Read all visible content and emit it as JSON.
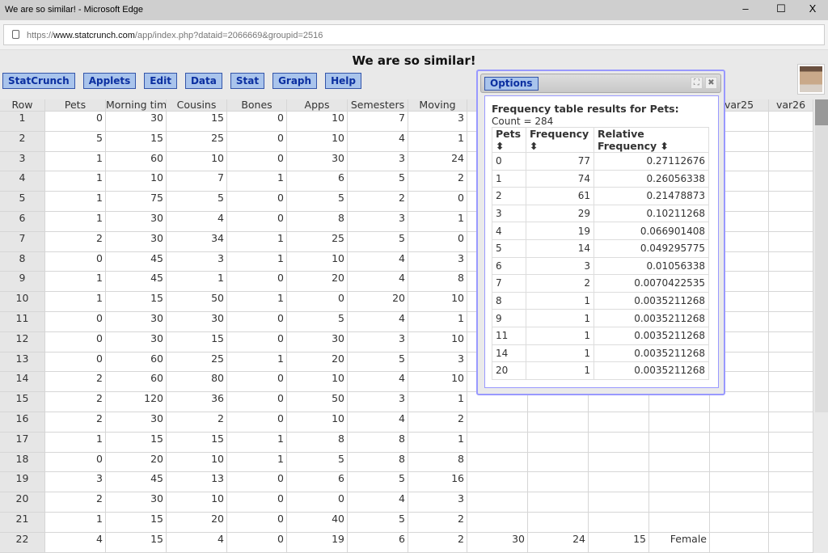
{
  "window": {
    "title": "We are so similar! - Microsoft Edge",
    "minimize": "–",
    "maximize": "☐",
    "close": "X"
  },
  "address": {
    "prefix": "https://",
    "domain": "www.statcrunch.com",
    "path": "/app/index.php?dataid=2066669&groupid=2516"
  },
  "page_title": "We are so similar!",
  "menu": [
    "StatCrunch",
    "Applets",
    "Edit",
    "Data",
    "Stat",
    "Graph",
    "Help"
  ],
  "grid": {
    "headers": [
      "Row",
      "Pets",
      "Morning tim",
      "Cousins",
      "Bones",
      "Apps",
      "Semesters",
      "Moving",
      "",
      "",
      "",
      "",
      "var25",
      "var26"
    ],
    "rows": [
      [
        "1",
        "0",
        "30",
        "15",
        "0",
        "10",
        "7",
        "3"
      ],
      [
        "2",
        "5",
        "15",
        "25",
        "0",
        "10",
        "4",
        "1"
      ],
      [
        "3",
        "1",
        "60",
        "10",
        "0",
        "30",
        "3",
        "24"
      ],
      [
        "4",
        "1",
        "10",
        "7",
        "1",
        "6",
        "5",
        "2"
      ],
      [
        "5",
        "1",
        "75",
        "5",
        "0",
        "5",
        "2",
        "0"
      ],
      [
        "6",
        "1",
        "30",
        "4",
        "0",
        "8",
        "3",
        "1"
      ],
      [
        "7",
        "2",
        "30",
        "34",
        "1",
        "25",
        "5",
        "0"
      ],
      [
        "8",
        "0",
        "45",
        "3",
        "1",
        "10",
        "4",
        "3"
      ],
      [
        "9",
        "1",
        "45",
        "1",
        "0",
        "20",
        "4",
        "8"
      ],
      [
        "10",
        "1",
        "15",
        "50",
        "1",
        "0",
        "20",
        "10"
      ],
      [
        "11",
        "0",
        "30",
        "30",
        "0",
        "5",
        "4",
        "1"
      ],
      [
        "12",
        "0",
        "30",
        "15",
        "0",
        "30",
        "3",
        "10"
      ],
      [
        "13",
        "0",
        "60",
        "25",
        "1",
        "20",
        "5",
        "3"
      ],
      [
        "14",
        "2",
        "60",
        "80",
        "0",
        "10",
        "4",
        "10"
      ],
      [
        "15",
        "2",
        "120",
        "36",
        "0",
        "50",
        "3",
        "1"
      ],
      [
        "16",
        "2",
        "30",
        "2",
        "0",
        "10",
        "4",
        "2"
      ],
      [
        "17",
        "1",
        "15",
        "15",
        "1",
        "8",
        "8",
        "1"
      ],
      [
        "18",
        "0",
        "20",
        "10",
        "1",
        "5",
        "8",
        "8"
      ],
      [
        "19",
        "3",
        "45",
        "13",
        "0",
        "6",
        "5",
        "16"
      ],
      [
        "20",
        "2",
        "30",
        "10",
        "0",
        "0",
        "4",
        "3"
      ],
      [
        "21",
        "1",
        "15",
        "20",
        "0",
        "40",
        "5",
        "2"
      ],
      [
        "22",
        "4",
        "15",
        "4",
        "0",
        "19",
        "6",
        "2",
        "30",
        "24",
        "15",
        "Female"
      ]
    ]
  },
  "dialog": {
    "options_label": "Options",
    "expand_icon": "⛶",
    "close_icon": "✖",
    "title": "Frequency table results for Pets:",
    "count": "Count = 284",
    "headers": [
      "Pets ⬍",
      "Frequency ⬍",
      "Relative Frequency ⬍"
    ],
    "rows": [
      [
        "0",
        "77",
        "0.27112676"
      ],
      [
        "1",
        "74",
        "0.26056338"
      ],
      [
        "2",
        "61",
        "0.21478873"
      ],
      [
        "3",
        "29",
        "0.10211268"
      ],
      [
        "4",
        "19",
        "0.066901408"
      ],
      [
        "5",
        "14",
        "0.049295775"
      ],
      [
        "6",
        "3",
        "0.01056338"
      ],
      [
        "7",
        "2",
        "0.0070422535"
      ],
      [
        "8",
        "1",
        "0.0035211268"
      ],
      [
        "9",
        "1",
        "0.0035211268"
      ],
      [
        "11",
        "1",
        "0.0035211268"
      ],
      [
        "14",
        "1",
        "0.0035211268"
      ],
      [
        "20",
        "1",
        "0.0035211268"
      ]
    ]
  }
}
